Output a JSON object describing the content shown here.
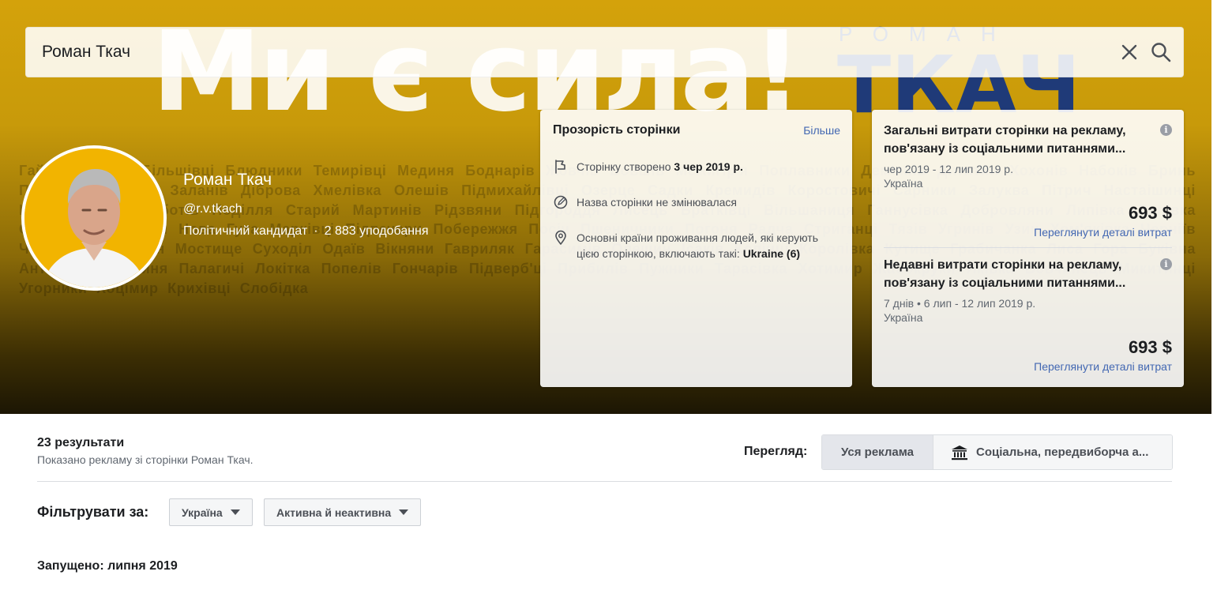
{
  "search": {
    "value": "Роман Ткач",
    "placeholder": ""
  },
  "cover": {
    "slogan": "Ми є сила!",
    "brand_top": "РОМАН",
    "brand": "ТКАЧ",
    "towns": "Гайок Висівка Більшівці Блюдники Темирівці Мединя Боднарів Жовчів Бовшів Межигір'я Поплавники Дем'янів Дитятин Хохонів Набоків Бринь Пукасівці Дубівці Заланів Діброва Хмелівка Олешів Підмихайлівці Озерце Садки Кремидів Коростовичі Сарники Залуква Пітрич Настаішинці Ісаків Крилос Суботів Поділля Старий Мартинів Рідзвяни Підгороддя Лисець Братківці Вільшаниця Ганнусівка Добровляни Липівка Липівка Студинець Майдан Нова Гута Марківці Підпечери Побережжя Посіч Пшеничники Погоня Радча Стриганці Тязів Угринів Узин Хом'яківка Черніїв Чорнолізці Будзин Мостище Суходіл Одаїв Вікняни Гавриляк Гарасимів Олещин Ісаків Колінці Королівка Кутище Грабичанка Лиса Гора Буківна Антонівка Остриня Палагичі Локітка Попелів Гончарів Підверб'ці Прибилів Пужники Тарасівка Хотимир Жабокруки Яківка Вовчинець Микитинці Угорники Хоцімир Крихівці Слобідка"
  },
  "profile": {
    "name": "Роман Ткач",
    "handle": "@r.v.tkach",
    "category": "Політичний кандидат",
    "likes": "2 883 уподобання"
  },
  "transparency": {
    "title": "Прозорість сторінки",
    "more_link": "Більше",
    "created_label": "Сторінку створено",
    "created_date": "3 чер 2019 р.",
    "name_unchanged": "Назва сторінки не змінювалася",
    "countries_text": "Основні країни проживання людей, які керують цією сторінкою, включають такі:",
    "countries_value": "Ukraine (6)"
  },
  "spending": {
    "total": {
      "title": "Загальні витрати сторінки на рекламу, пов'язану із соціальними питаннями...",
      "dates": "чер 2019 - 12 лип 2019 р.",
      "country": "Україна",
      "amount": "693 $",
      "details_link": "Переглянути деталі витрат"
    },
    "recent": {
      "title": "Недавні витрати сторінки на рекламу, пов'язану із соціальними питаннями...",
      "dates": "7 днів • 6 лип - 12 лип 2019 р.",
      "country": "Україна",
      "amount": "693 $",
      "details_link": "Переглянути деталі витрат"
    }
  },
  "results": {
    "count": "23 результати",
    "subtitle": "Показано рекламу зі сторінки Роман Ткач."
  },
  "view": {
    "label": "Перегляд:",
    "all_ads": "Уся реклама",
    "social": "Соціальна, передвиборча а..."
  },
  "filters": {
    "label": "Фільтрувати за:",
    "country": "Україна",
    "status": "Активна й неактивна"
  },
  "launched": "Запущено: липня 2019",
  "colors": {
    "accent_link": "#4267b2",
    "cover_gold": "#d4a20b",
    "brand_blue": "#1f3a78"
  }
}
